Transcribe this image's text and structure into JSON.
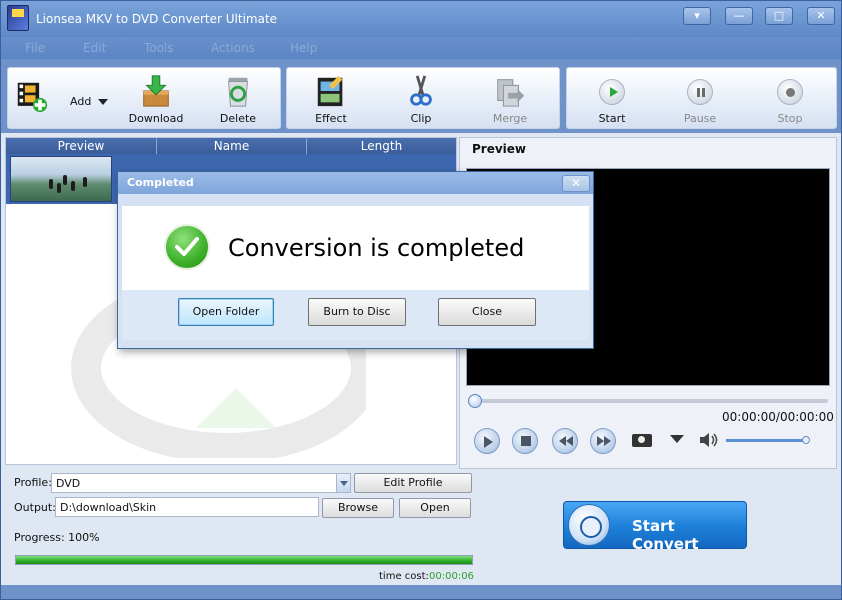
{
  "window": {
    "title": "Lionsea MKV to DVD Converter Ultimate",
    "controls": [
      "▾",
      "—",
      "□",
      "✕"
    ]
  },
  "menu": [
    "File",
    "Edit",
    "Tools",
    "Actions",
    "Help"
  ],
  "toolbar": {
    "add": "Add",
    "download": "Download",
    "delete": "Delete",
    "effect": "Effect",
    "clip": "Clip",
    "merge": "Merge",
    "start": "Start",
    "pause": "Pause",
    "stop": "Stop"
  },
  "list": {
    "columns": [
      "Preview",
      "Name",
      "Length"
    ]
  },
  "preview": {
    "title": "Preview",
    "timecode": "00:00:00/00:00:00",
    "seek_fraction": 0.0,
    "volume_fraction": 0.95
  },
  "bottom": {
    "profile_label": "Profile:",
    "profile_value": "DVD",
    "edit_profile": "Edit Profile",
    "output_label": "Output:",
    "output_value": "D:\\download\\Skin",
    "browse": "Browse",
    "open": "Open",
    "progress_label": "Progress: 100%",
    "progress_fraction": 1.0,
    "time_cost_label": "time cost:",
    "time_cost_value": "00:00:06",
    "start_convert": "Start Convert"
  },
  "dialog": {
    "title": "Completed",
    "close": "✕",
    "message": "Conversion is completed",
    "open_folder": "Open Folder",
    "burn_to_disc": "Burn to Disc",
    "close_button": "Close"
  },
  "colors": {
    "titlebar": "#6a95d0",
    "list_header": "#3f62a3",
    "selected_row": "#3c67b0",
    "progress": "#2fb02c",
    "start_convert": "#1c7fd8"
  }
}
